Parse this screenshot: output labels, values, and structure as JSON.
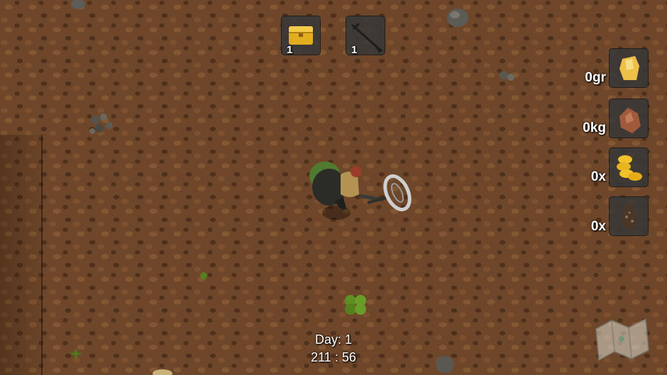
{
  "inventory": [
    {
      "item": "treasure-chest-icon",
      "count": "1"
    },
    {
      "item": "shovel-icon",
      "count": "1"
    }
  ],
  "resources": [
    {
      "item": "gold-nugget-icon",
      "amount": "0gr"
    },
    {
      "item": "rock-ore-icon",
      "amount": "0kg"
    },
    {
      "item": "coins-icon",
      "amount": "0x"
    },
    {
      "item": "seed-meteorite-icon",
      "amount": "0x"
    }
  ],
  "hud": {
    "day": "Day: 1",
    "time": "211 : 56"
  },
  "map_button": {
    "icon": "map-icon"
  },
  "colors": {
    "ground": "#6e4629",
    "slot_bg": "#373737",
    "text": "#ffffff",
    "gold": "#e8b82a"
  }
}
